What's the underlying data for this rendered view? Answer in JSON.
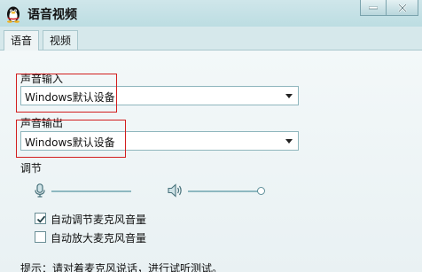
{
  "window": {
    "title": "语音视频"
  },
  "tabs": [
    {
      "label": "语音",
      "active": true
    },
    {
      "label": "视频",
      "active": false
    }
  ],
  "voice": {
    "input_label": "声音输入",
    "input_device": "Windows默认设备",
    "output_label": "声音输出",
    "output_device": "Windows默认设备",
    "adjust_label": "调节",
    "mic_level": 0.0,
    "speaker_level": 1.0,
    "auto_adjust_mic": {
      "label": "自动调节麦克风音量",
      "checked": true
    },
    "auto_amplify_mic": {
      "label": "自动放大麦克风音量",
      "checked": false
    },
    "hint": "提示：请对着麦克风说话，进行试听测试。"
  },
  "colors": {
    "highlight": "#d21e1e",
    "titlebar": "#bcdde2",
    "background": "#eef4f5"
  },
  "icons": [
    "qq-penguin-icon",
    "minimize-icon",
    "close-icon",
    "microphone-icon",
    "speaker-icon",
    "check-icon",
    "dropdown-arrow-icon"
  ]
}
